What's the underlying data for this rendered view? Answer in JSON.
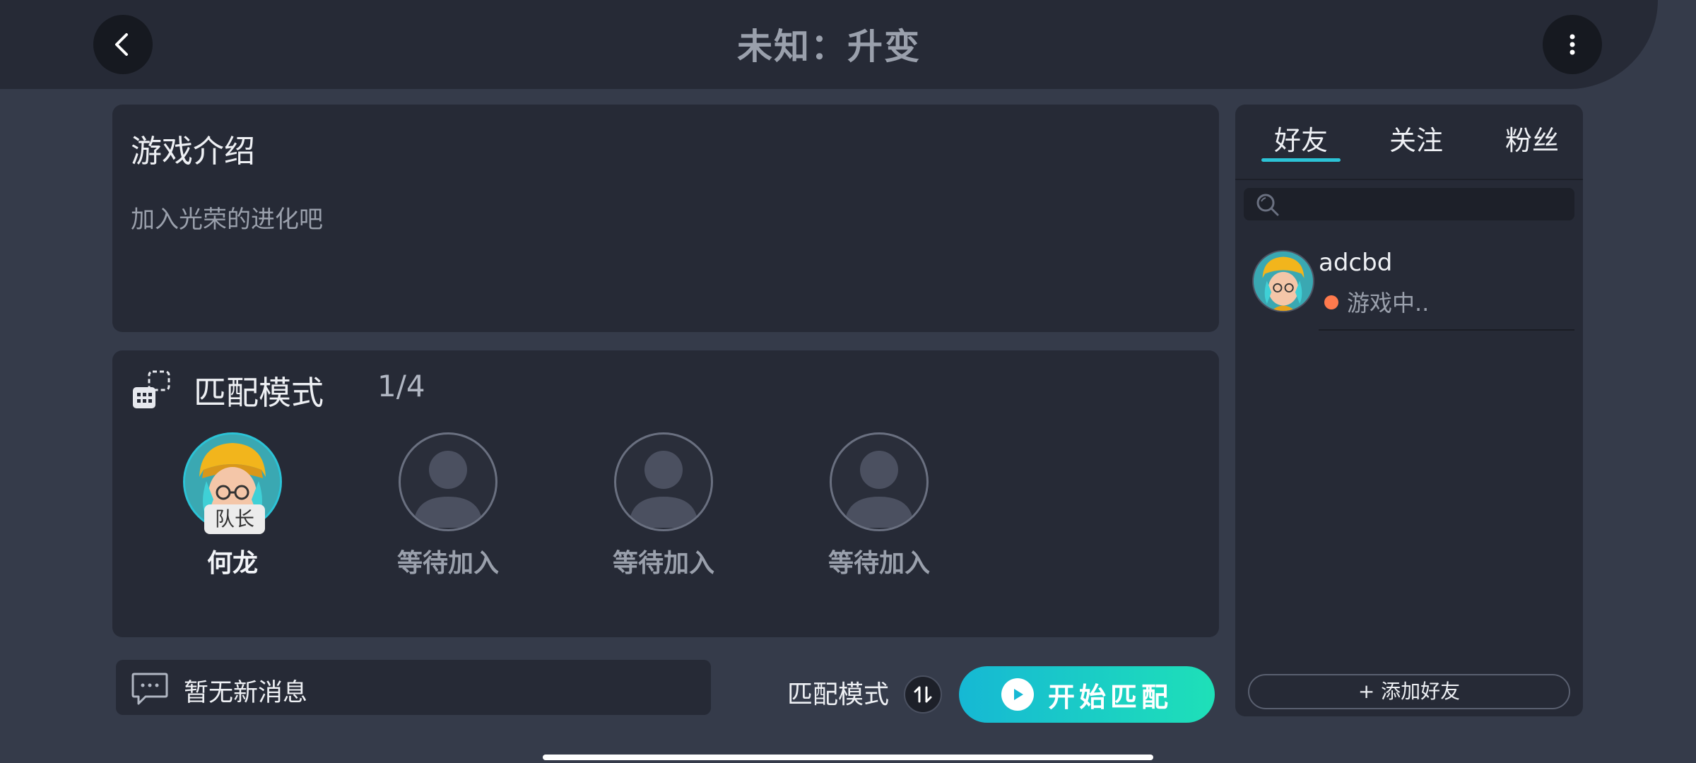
{
  "header": {
    "title": "未知：升变",
    "back_icon": "chevron-left-icon",
    "more_icon": "more-vertical-icon"
  },
  "intro": {
    "title": "游戏介绍",
    "text": "加入光荣的进化吧"
  },
  "match": {
    "icon": "match-mode-icon",
    "title": "匹配模式",
    "count": "1/4",
    "slots": [
      {
        "name": "何龙",
        "badge": "队长",
        "filled": true
      },
      {
        "name": "等待加入",
        "filled": false
      },
      {
        "name": "等待加入",
        "filled": false
      },
      {
        "name": "等待加入",
        "filled": false
      }
    ]
  },
  "messages": {
    "icon": "chat-icon",
    "text": "暂无新消息"
  },
  "bottom": {
    "mode_label": "匹配模式",
    "swap_icon": "swap-icon",
    "start_label": "开始匹配",
    "start_icon": "play-icon"
  },
  "friends": {
    "tabs": [
      "好友",
      "关注",
      "粉丝"
    ],
    "active_tab": "好友",
    "search_icon": "search-icon",
    "list": [
      {
        "name": "adcbd",
        "status": "游戏中..",
        "status_color": "#ff7a4d"
      }
    ],
    "add_label": "+ 添加好友"
  },
  "colors": {
    "accent": "#2cc3d6",
    "background": "#353b4a",
    "panel": "#262a36"
  }
}
